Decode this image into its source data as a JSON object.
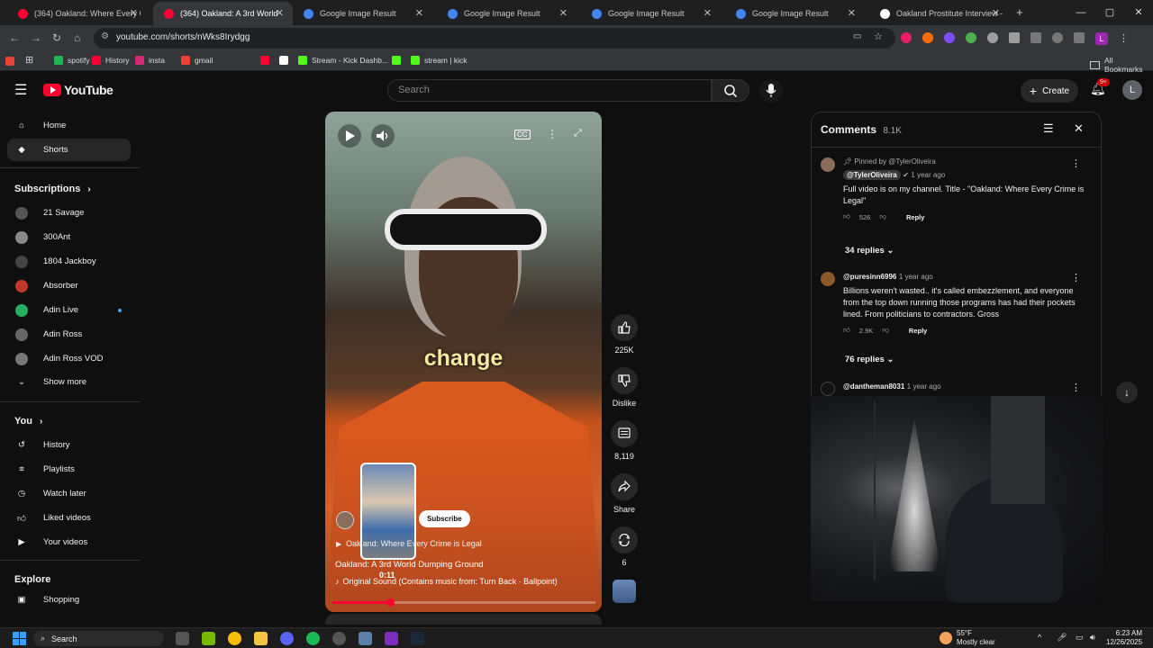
{
  "browser": {
    "tabs": [
      {
        "title": "(364) Oakland: Where Every Cri",
        "active": false
      },
      {
        "title": "(364) Oakland: A 3rd World",
        "active": true
      },
      {
        "title": "Google Image Result",
        "active": false
      },
      {
        "title": "Google Image Result",
        "active": false
      },
      {
        "title": "Google Image Result",
        "active": false
      },
      {
        "title": "Google Image Result",
        "active": false
      },
      {
        "title": "Oakland Prostitute Interview - ",
        "active": false
      }
    ],
    "url": "youtube.com/shorts/nWks8Irydgg",
    "bookmarks": [
      {
        "label": "spotify",
        "color": "#1db954"
      },
      {
        "label": "History",
        "color": "#ff0033"
      },
      {
        "label": "insta",
        "color": "#d62976"
      },
      {
        "label": "gmail",
        "color": "#ea4335"
      },
      {
        "label": "",
        "color": "#ff0033"
      },
      {
        "label": "",
        "color": "#ffffff"
      },
      {
        "label": "Stream - Kick Dashb...",
        "color": "#53fc18"
      },
      {
        "label": "",
        "color": "#53fc18"
      },
      {
        "label": "stream | kick",
        "color": "#53fc18"
      }
    ],
    "all_bookmarks": "All Bookmarks"
  },
  "youtube": {
    "logo": "YouTube",
    "search_placeholder": "Search",
    "create_label": "Create",
    "notif_badge": "9+",
    "account_initial": "L"
  },
  "sidebar": {
    "top": [
      {
        "label": "Home",
        "icon": "home-icon"
      },
      {
        "label": "Shorts",
        "icon": "shorts-icon"
      }
    ],
    "subscriptions_title": "Subscriptions",
    "subscriptions": [
      {
        "label": "21 Savage",
        "color": "#555"
      },
      {
        "label": "300Ant",
        "color": "#888"
      },
      {
        "label": "1804 Jackboy",
        "color": "#444"
      },
      {
        "label": "Absorber",
        "color": "#c0392b"
      },
      {
        "label": "Adin Live",
        "color": "#27ae60"
      },
      {
        "label": "Adin Ross",
        "color": "#666"
      },
      {
        "label": "Adin Ross VOD",
        "color": "#777"
      }
    ],
    "show_more": "Show more",
    "you_title": "You",
    "you_items": [
      {
        "label": "History",
        "icon": "history-icon"
      },
      {
        "label": "Playlists",
        "icon": "playlists-icon"
      },
      {
        "label": "Watch later",
        "icon": "clock-icon"
      },
      {
        "label": "Liked videos",
        "icon": "thumbs-up-icon"
      },
      {
        "label": "Your videos",
        "icon": "video-icon"
      }
    ],
    "explore_title": "Explore",
    "explore_items": [
      {
        "label": "Shopping",
        "icon": "bag-icon"
      }
    ]
  },
  "video": {
    "caption": "change",
    "channel_title": "Oakland: Where Every Crime is Legal",
    "title": "Oakland: A 3rd World Dumping Ground",
    "sound": "Original Sound (Contains music from: Turn Back · Ballpoint)",
    "time": "0:11",
    "subscribe": "Subscribe",
    "progress": 0.22
  },
  "actions": {
    "likes": "225K",
    "dislike": "Dislike",
    "comments": "8,119",
    "share": "Share",
    "remix": "6"
  },
  "comments_panel": {
    "title": "Comments",
    "count": "8.1K",
    "items": [
      {
        "pinned": "Pinned by @TylerOliveira",
        "author": "@TylerOliveira",
        "age": "1 year ago",
        "text": "Full video is on my channel. Title - \"Oakland: Where Every Crime is Legal\"",
        "likes": "526",
        "reply": "Reply",
        "replies": "34 replies"
      },
      {
        "author": "@puresinn6996",
        "age": "1 year ago",
        "text": "Billions weren't wasted.. it's called embezzlement, and everyone from the top down running those programs has had their pockets lined. From politicians to contractors. Gross",
        "likes": "2.9K",
        "reply": "Reply",
        "replies": "76 replies"
      },
      {
        "author": "@dantheman8031",
        "age": "1 year ago"
      }
    ]
  },
  "taskbar": {
    "search": "Search",
    "temp": "55°F",
    "weather": "Mostly clear",
    "time": "6:23 AM",
    "date": "12/26/2025"
  }
}
